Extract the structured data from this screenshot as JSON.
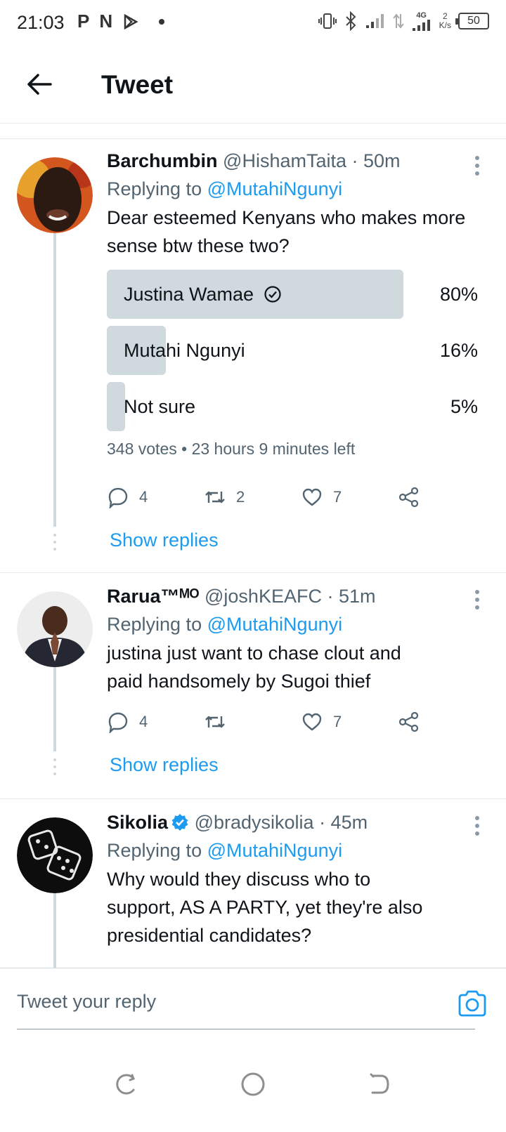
{
  "status_bar": {
    "time": "21:03",
    "left_icons": [
      "P",
      "N",
      "play-store-icon"
    ],
    "network": "4G",
    "speed": "2",
    "speed_unit": "K/s",
    "battery": "50"
  },
  "header": {
    "title": "Tweet"
  },
  "tweets": [
    {
      "name": "Barchumbin",
      "handle": "@HishamTaita",
      "time": "· 50m",
      "replying_prefix": "Replying to",
      "replying_to": "@MutahiNgunyi",
      "text": "Dear esteemed Kenyans who makes more sense btw these two?",
      "poll": {
        "options": [
          {
            "label": "Justina Wamae",
            "percent": "80%",
            "fraction": 0.8,
            "winner": true
          },
          {
            "label": "Mutahi Ngunyi",
            "percent": "16%",
            "fraction": 0.16,
            "winner": false
          },
          {
            "label": "Not sure",
            "percent": "5%",
            "fraction": 0.05,
            "winner": false
          }
        ],
        "meta": "348 votes • 23 hours 9 minutes left"
      },
      "actions": {
        "replies": "4",
        "retweets": "2",
        "likes": "7"
      },
      "show_replies": "Show replies"
    },
    {
      "name": "Rarua™ᴹᴼ",
      "handle": "@joshKEAFC",
      "time": "· 51m",
      "replying_prefix": "Replying to",
      "replying_to": "@MutahiNgunyi",
      "text_lines": [
        "justina just want to chase clout and",
        "paid handsomely by Sugoi thief"
      ],
      "actions": {
        "replies": "4",
        "retweets": "",
        "likes": "7"
      },
      "show_replies": "Show replies"
    },
    {
      "name": "Sikolia",
      "verified": true,
      "handle": "@bradysikolia",
      "time": "· 45m",
      "replying_prefix": "Replying to",
      "replying_to": "@MutahiNgunyi",
      "text_lines": [
        "Why would they discuss who to",
        "support, AS A PARTY, yet they're also",
        "presidential candidates?"
      ]
    }
  ],
  "composer": {
    "placeholder": "Tweet your reply"
  },
  "colors": {
    "accent": "#1d9bf0",
    "poll_fill": "#cfd9de",
    "secondary_text": "#536471"
  }
}
